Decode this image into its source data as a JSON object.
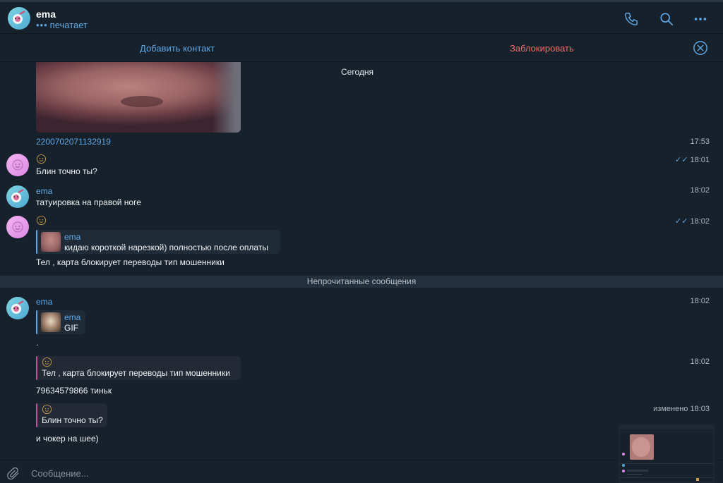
{
  "header": {
    "name": "ema",
    "status": "печатает",
    "icons": [
      "phone-icon",
      "search-icon",
      "more-icon"
    ]
  },
  "actions": {
    "add_contact": "Добавить контакт",
    "block": "Заблокировать"
  },
  "chat": {
    "date_divider": "Сегодня",
    "media_message": {
      "link": "2200702071132919",
      "time": "17:53"
    },
    "messages": [
      {
        "sender_icon": "smile-icon",
        "text": "Блин точно ты?",
        "time": "18:01",
        "read": true
      },
      {
        "sender": "ema",
        "text": "татуировка на правой ноге",
        "time": "18:02"
      },
      {
        "sender_icon": "smile-icon",
        "reply_name": "ema",
        "reply_text": "кидаю короткой нарезкой) полностью после оплаты",
        "text": "Тел , карта блокирует переводы тип мошенники",
        "time": "18:02",
        "read": true
      }
    ],
    "unread_divider": "Непрочитанные сообщения",
    "unread_messages": [
      {
        "sender": "ema",
        "reply_name": "ema",
        "reply_text": "GIF",
        "text": ".",
        "time": "18:02"
      },
      {
        "reply_text": "Тел , карта блокирует переводы тип мошенники",
        "text": "79634579866 тиньк",
        "time": "18:02"
      },
      {
        "reply_text": "Блин точно ты?",
        "text": "и чокер на шее)",
        "time": "изменено 18:03"
      }
    ]
  },
  "composer": {
    "placeholder": "Сообщение..."
  },
  "colors": {
    "background": "#17212b",
    "accent": "#5fa8e6",
    "danger": "#ec6f6a",
    "unread_bar": "#232f3c"
  }
}
